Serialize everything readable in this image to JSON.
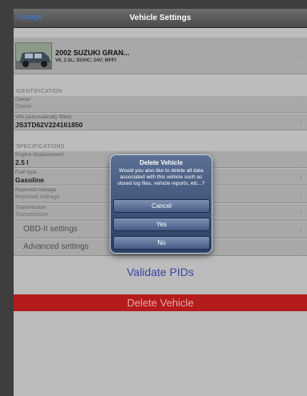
{
  "navbar": {
    "back_label": "Garage",
    "title": "Vehicle Settings"
  },
  "vehicle": {
    "title": "2002 SUZUKI GRAN...",
    "subtitle": "V6, 2.5L; DOHC; 24V; MPFI"
  },
  "identification": {
    "header": "IDENTIFICATION",
    "owner": {
      "label": "Owner",
      "value": "Owner"
    },
    "vin": {
      "label": "VIN (automatically filled)",
      "value": "JS3TD62V224161850"
    }
  },
  "specifications": {
    "header": "SPECIFICATIONS",
    "engine": {
      "label": "Engine displacement",
      "value": "2.5 l"
    },
    "fuel": {
      "label": "Fuel type",
      "value": "Gasoline"
    },
    "mileage": {
      "label": "Reported mileage",
      "value": "Reported mileage"
    },
    "transmission": {
      "label": "Transmission",
      "value": "Transmission"
    }
  },
  "settings": {
    "obd": "OBD-II settings",
    "advanced": "Advanced settings"
  },
  "validate_label": "Validate PIDs",
  "delete_label": "Delete Vehicle",
  "dialog": {
    "title": "Delete Vehicle",
    "message": "Would you also like to delete all data associated with this vehicle such as stored log files, vehicle reports, etc...?",
    "cancel": "Cancel",
    "yes": "Yes",
    "no": "No"
  },
  "icons": {
    "chevron": "chevron-right-icon",
    "car": "car-photo"
  },
  "colors": {
    "delete_bar": "#b41c1c",
    "validate_text": "#3a44a6",
    "dialog_bg": "#2b3f66"
  }
}
